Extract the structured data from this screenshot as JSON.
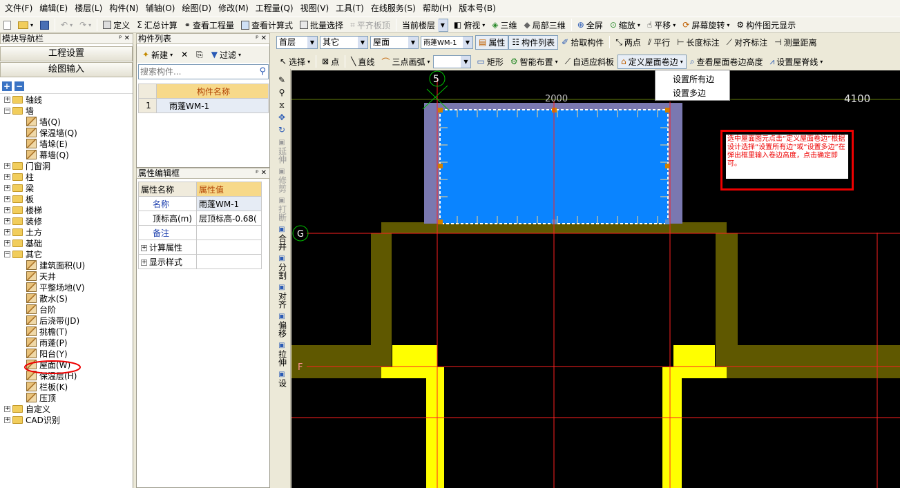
{
  "menu": [
    "文件(F)",
    "编辑(E)",
    "楼层(L)",
    "构件(N)",
    "辅轴(O)",
    "绘图(D)",
    "修改(M)",
    "工程量(Q)",
    "视图(V)",
    "工具(T)",
    "在线服务(S)",
    "帮助(H)",
    "版本号(B)"
  ],
  "toolbar1": {
    "define": "定义",
    "summary": "汇总计算",
    "view_qty": "查看工程量",
    "view_formula": "查看计算式",
    "batch_select": "批量选择",
    "flush_slab": "平齐板顶",
    "current_floor": "当前楼层",
    "top_view": "俯视",
    "three_d": "三维",
    "local_3d": "局部三维",
    "fullscreen": "全屏",
    "zoom": "缩放",
    "pan": "平移",
    "rotate": "屏幕旋转",
    "comp_display": "构件图元显示"
  },
  "nav": {
    "title": "模块导航栏",
    "btn_project": "工程设置",
    "btn_draw": "绘图输入",
    "tree": [
      {
        "label": "轴线",
        "level": 0,
        "expanded": false
      },
      {
        "label": "墙",
        "level": 0,
        "expanded": true
      },
      {
        "label": "墙(Q)",
        "level": 1
      },
      {
        "label": "保温墙(Q)",
        "level": 1
      },
      {
        "label": "墙垛(E)",
        "level": 1
      },
      {
        "label": "幕墙(Q)",
        "level": 1
      },
      {
        "label": "门窗洞",
        "level": 0,
        "expanded": false
      },
      {
        "label": "柱",
        "level": 0,
        "expanded": false
      },
      {
        "label": "梁",
        "level": 0,
        "expanded": false
      },
      {
        "label": "板",
        "level": 0,
        "expanded": false
      },
      {
        "label": "楼梯",
        "level": 0,
        "expanded": false
      },
      {
        "label": "装修",
        "level": 0,
        "expanded": false
      },
      {
        "label": "土方",
        "level": 0,
        "expanded": false
      },
      {
        "label": "基础",
        "level": 0,
        "expanded": false
      },
      {
        "label": "其它",
        "level": 0,
        "expanded": true
      },
      {
        "label": "建筑面积(U)",
        "level": 1
      },
      {
        "label": "天井",
        "level": 1
      },
      {
        "label": "平整场地(V)",
        "level": 1
      },
      {
        "label": "散水(S)",
        "level": 1
      },
      {
        "label": "台阶",
        "level": 1
      },
      {
        "label": "后浇带(JD)",
        "level": 1
      },
      {
        "label": "挑檐(T)",
        "level": 1
      },
      {
        "label": "雨蓬(P)",
        "level": 1
      },
      {
        "label": "阳台(Y)",
        "level": 1
      },
      {
        "label": "屋面(W)",
        "level": 1,
        "highlight": true
      },
      {
        "label": "保温层(H)",
        "level": 1
      },
      {
        "label": "栏板(K)",
        "level": 1
      },
      {
        "label": "压顶",
        "level": 1
      },
      {
        "label": "自定义",
        "level": 0,
        "expanded": false
      },
      {
        "label": "CAD识别",
        "level": 0,
        "expanded": false
      }
    ]
  },
  "complist": {
    "title": "构件列表",
    "new": "新建",
    "filter": "过滤",
    "search_placeholder": "搜索构件...",
    "col_name": "构件名称",
    "rows": [
      {
        "idx": "1",
        "name": "雨蓬WM-1"
      }
    ]
  },
  "props": {
    "title": "属性编辑框",
    "col_name": "属性名称",
    "col_value": "属性值",
    "rows": [
      {
        "name": "名称",
        "value": "雨蓬WM-1",
        "blue": true
      },
      {
        "name": "顶标高(m)",
        "value": "层顶标高-0.68(",
        "blue": false
      },
      {
        "name": "备注",
        "value": "",
        "blue": true
      },
      {
        "name": "计算属性",
        "value": "",
        "group": true
      },
      {
        "name": "显示样式",
        "value": "",
        "group": true
      }
    ]
  },
  "toolbar2": {
    "floor": "首层",
    "type": "其它",
    "category": "屋面",
    "component": "雨蓬WM-1",
    "property": "属性",
    "comp_list": "构件列表",
    "pick": "拾取构件",
    "two_points": "两点",
    "parallel": "平行",
    "length_dim": "长度标注",
    "align_dim": "对齐标注",
    "measure": "测量距离"
  },
  "toolbar3": {
    "select": "选择",
    "point": "点",
    "line": "直线",
    "arc3": "三点画弧",
    "rect": "矩形",
    "smart": "智能布置",
    "adaptive_slope": "自适应斜板",
    "define_roll": "定义屋面卷边",
    "view_roll": "查看屋面卷边高度",
    "ridge": "设置屋脊线"
  },
  "vtools": [
    "延伸",
    "修剪",
    "打断",
    "合并",
    "分割",
    "对齐",
    "偏移",
    "拉伸",
    "设"
  ],
  "dropdown": [
    "设置所有边",
    "设置多边"
  ],
  "canvas": {
    "axis_5": "5",
    "axis_g": "G",
    "axis_f": "F",
    "dim_top": "2000",
    "dim_right": "4100"
  },
  "note": "选中屋面图元点击“定义屋面卷边”根据设计选择“设置所有边”或“设置多边”在弹出框里输入卷边高度，点击确定即可。"
}
